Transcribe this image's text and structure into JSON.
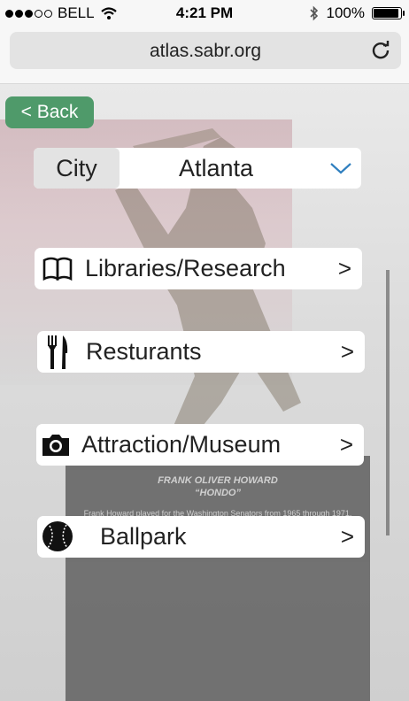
{
  "status_bar": {
    "carrier": "BELL",
    "time": "4:21 PM",
    "battery": "100%",
    "signal_bars": 3,
    "signal_total": 5
  },
  "browser": {
    "url": "atlas.sabr.org"
  },
  "background": {
    "plaque_title": "FRANK OLIVER HOWARD",
    "plaque_subtitle": "“HONDO”",
    "plaque_text": "Frank Howard played for the Washington Senators from 1965 through 1971."
  },
  "nav": {
    "back_label": "< Back"
  },
  "city": {
    "label": "City",
    "value": "Atlanta"
  },
  "menu": {
    "items": [
      {
        "label": "Libraries/Research",
        "arrow": ">",
        "icon": "book-icon"
      },
      {
        "label": "Resturants",
        "arrow": ">",
        "icon": "fork-knife-icon"
      },
      {
        "label": "Attraction/Museum",
        "arrow": ">",
        "icon": "camera-icon"
      },
      {
        "label": "Ballpark",
        "arrow": ">",
        "icon": "baseball-icon"
      }
    ]
  },
  "colors": {
    "back_button": "#4f9a6a",
    "chevron": "#2f7fbf"
  }
}
